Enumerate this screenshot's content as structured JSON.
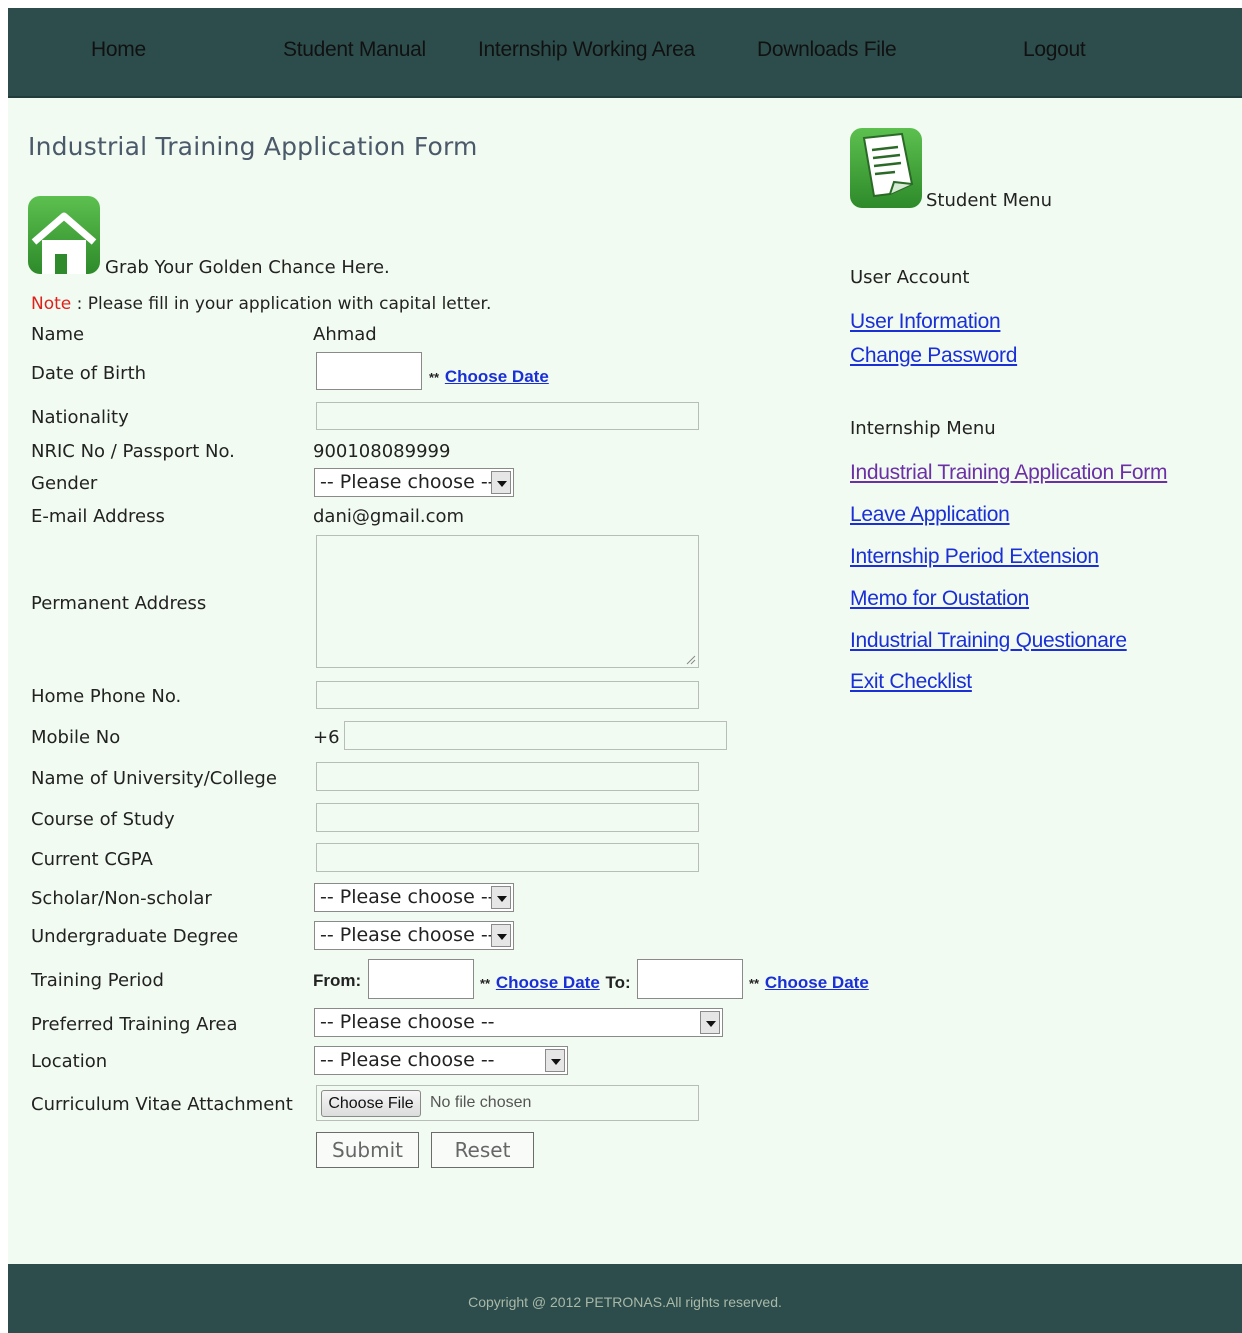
{
  "nav": {
    "items": [
      "Home",
      "Student Manual",
      "Internship Working Area",
      "Downloads File",
      "Logout"
    ]
  },
  "page": {
    "title": "Industrial Training Application Form",
    "tagline": "Grab Your Golden Chance Here.",
    "note_label": "Note",
    "note_text": " : Please fill in your application with capital letter."
  },
  "form": {
    "name_label": "Name",
    "name_value": "Ahmad",
    "dob_label": "Date of Birth",
    "stars": "**",
    "choose_date": "Choose Date",
    "nationality_label": "Nationality",
    "nric_label": "NRIC No / Passport No.",
    "nric_value": "900108089999",
    "gender_label": "Gender",
    "please_choose": "-- Please choose --",
    "email_label": "E-mail Address",
    "email_value": "dani@gmail.com",
    "address_label": "Permanent Address",
    "home_phone_label": "Home Phone No.",
    "mobile_label": "Mobile No",
    "mobile_prefix": "+6",
    "university_label": "Name of University/College",
    "course_label": "Course of Study",
    "cgpa_label": "Current CGPA",
    "scholar_label": "Scholar/Non-scholar",
    "degree_label": "Undergraduate Degree",
    "period_label": "Training Period",
    "from_label": "From:",
    "to_label": "To:",
    "area_label": "Preferred Training Area",
    "location_label": "Location",
    "cv_label": "Curriculum Vitae Attachment",
    "choose_file": "Choose File",
    "no_file": "No file chosen",
    "submit": "Submit",
    "reset": "Reset"
  },
  "sidebar": {
    "title": "Student Menu",
    "user_account_heading": "User Account",
    "user_links": [
      "User Information",
      "Change Password"
    ],
    "internship_heading": "Internship Menu",
    "internship_links": [
      "Industrial Training Application Form",
      "Leave Application",
      "Internship Period Extension",
      "Memo for Oustation",
      "Industrial Training Questionare",
      "Exit Checklist"
    ]
  },
  "footer": {
    "copyright": "Copyright @ 2012 PETRONAS.All rights reserved."
  },
  "colors": {
    "nav_bg": "#2c4d4c",
    "page_bg": "#f2fbf2",
    "link": "#1a2fd6",
    "visited_link": "#6b2fa6",
    "note_red": "#e0201b",
    "icon_green": "#3aa234"
  }
}
